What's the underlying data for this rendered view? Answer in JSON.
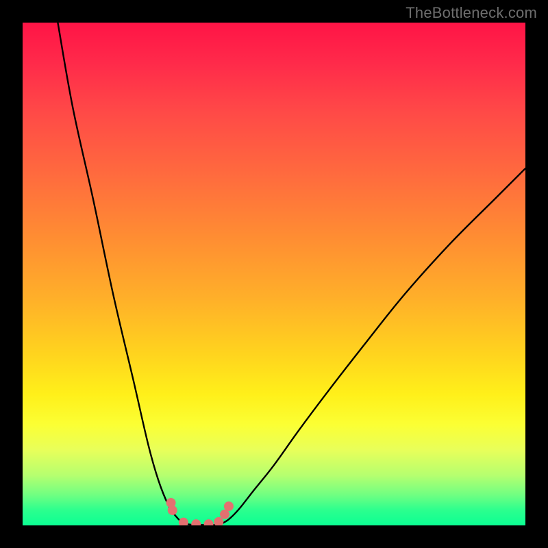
{
  "watermark": {
    "text": "TheBottleneck.com"
  },
  "colors": {
    "background": "#000000",
    "curve_stroke": "#000000",
    "marker_fill": "#e37070",
    "watermark": "#6e6e6e"
  },
  "chart_data": {
    "type": "line",
    "title": "",
    "xlabel": "",
    "ylabel": "",
    "xlim": [
      0,
      100
    ],
    "ylim": [
      0,
      100
    ],
    "grid": false,
    "legend": false,
    "series": [
      {
        "name": "left-branch",
        "x": [
          7,
          10,
          14,
          18,
          22,
          25,
          27,
          29,
          30.5,
          31.5,
          32.5
        ],
        "values": [
          100,
          83,
          65,
          46,
          29,
          16,
          9,
          4,
          1.8,
          0.8,
          0.3
        ]
      },
      {
        "name": "floor",
        "x": [
          32.5,
          34,
          36,
          38,
          39.5
        ],
        "values": [
          0.3,
          0.1,
          0.1,
          0.1,
          0.3
        ]
      },
      {
        "name": "right-branch",
        "x": [
          39.5,
          41,
          43,
          46,
          50,
          55,
          61,
          68,
          76,
          85,
          94,
          100
        ],
        "values": [
          0.3,
          1.2,
          3.2,
          7.0,
          12,
          19,
          27,
          36,
          46,
          56,
          65,
          71
        ]
      }
    ],
    "markers": {
      "name": "bottom-dots",
      "x": [
        29.5,
        29.8,
        32.0,
        34.5,
        37.0,
        39.0,
        40.2,
        41.0
      ],
      "values": [
        4.5,
        3.0,
        0.6,
        0.25,
        0.25,
        0.7,
        2.2,
        3.8
      ],
      "r": 7
    },
    "gradient_stops": [
      {
        "pos": 0.0,
        "color": "#ff1446"
      },
      {
        "pos": 0.3,
        "color": "#ff6a3e"
      },
      {
        "pos": 0.66,
        "color": "#ffd41e"
      },
      {
        "pos": 0.85,
        "color": "#e8ff5a"
      },
      {
        "pos": 1.0,
        "color": "#0cff93"
      }
    ]
  }
}
